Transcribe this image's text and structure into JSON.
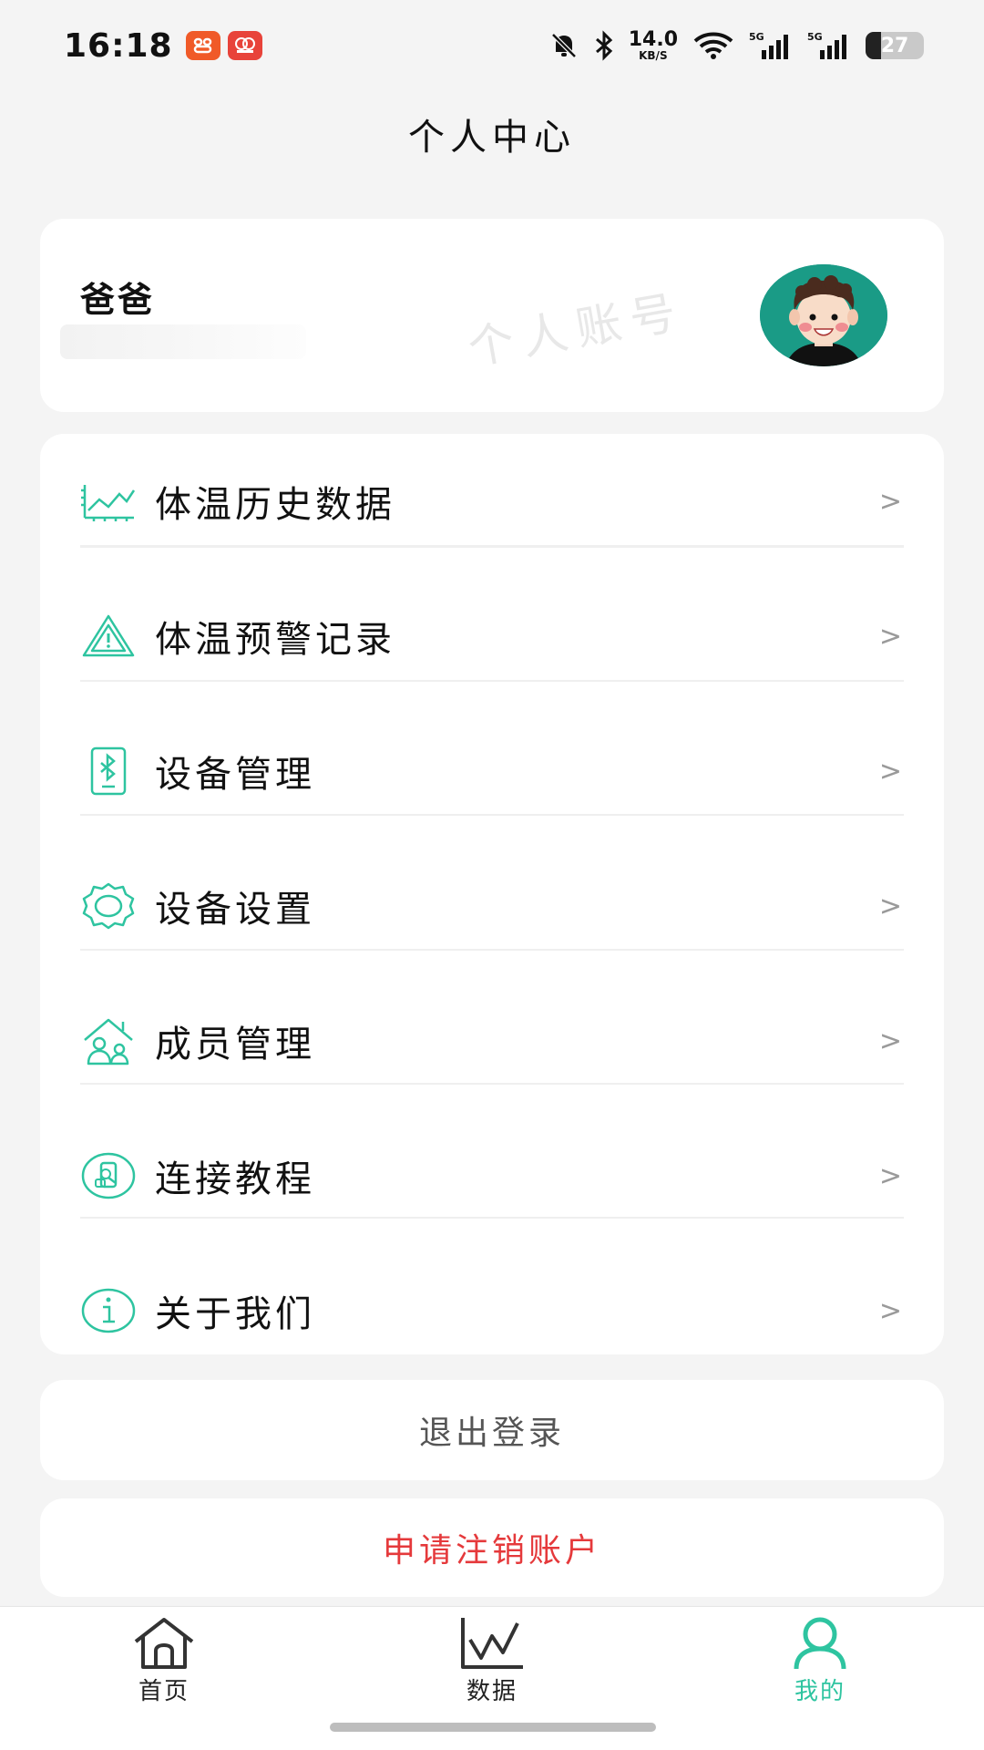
{
  "status_bar": {
    "time": "16:18",
    "net_speed_value": "14.0",
    "net_speed_unit": "KB/S",
    "battery": "27",
    "badges": [
      {
        "name": "shopping-app-badge",
        "color": "#f05a28"
      },
      {
        "name": "red-app-badge",
        "color": "#e8433a"
      }
    ]
  },
  "header": {
    "title": "个人中心"
  },
  "profile": {
    "name": "爸爸",
    "watermark": "个人账号"
  },
  "menu": {
    "items": [
      {
        "label": "体温历史数据",
        "icon": "chart-icon"
      },
      {
        "label": "体温预警记录",
        "icon": "warning-icon"
      },
      {
        "label": "设备管理",
        "icon": "bluetooth-device-icon"
      },
      {
        "label": "设备设置",
        "icon": "gear-icon"
      },
      {
        "label": "成员管理",
        "icon": "family-icon"
      },
      {
        "label": "连接教程",
        "icon": "tutorial-icon"
      },
      {
        "label": "关于我们",
        "icon": "info-icon"
      }
    ],
    "chevron": ">"
  },
  "actions": {
    "logout": "退出登录",
    "deregister": "申请注销账户"
  },
  "bottom_nav": {
    "items": [
      {
        "label": "首页",
        "icon": "home-icon"
      },
      {
        "label": "数据",
        "icon": "data-chart-icon"
      },
      {
        "label": "我的",
        "icon": "person-icon",
        "active": true
      }
    ]
  },
  "colors": {
    "accent": "#2ec4a0",
    "danger": "#e5393b",
    "background": "#f4f4f4"
  }
}
